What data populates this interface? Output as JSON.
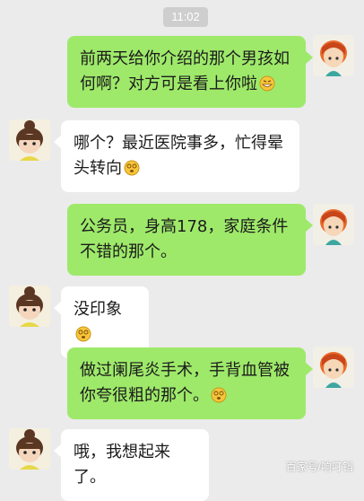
{
  "status_bar": {
    "time": "11:02"
  },
  "messages": [
    {
      "direction": "out",
      "text": "前两天给你介绍的那个男孩如何啊？对方可是看上你啦",
      "emoji": "grin-emoji"
    },
    {
      "direction": "in",
      "text": "哪个？最近医院事多，忙得晕头转向",
      "emoji": "dizzy-emoji"
    },
    {
      "direction": "out",
      "text": "公务员，身高178，家庭条件不错的那个。",
      "emoji": ""
    },
    {
      "direction": "in",
      "text": "没印象",
      "emoji": "dizzy-emoji"
    },
    {
      "direction": "out",
      "text": "做过阑尾炎手术，手背血管被你夸很粗的那个。",
      "emoji": "dizzy-emoji"
    },
    {
      "direction": "in",
      "text": "哦，我想起来了。",
      "emoji": ""
    }
  ],
  "watermark": "百家号/响叮铛",
  "colors": {
    "background": "#ebebeb",
    "outgoing_bubble": "#9ee96a",
    "incoming_bubble": "#ffffff",
    "timestamp_bg": "#cecece"
  }
}
